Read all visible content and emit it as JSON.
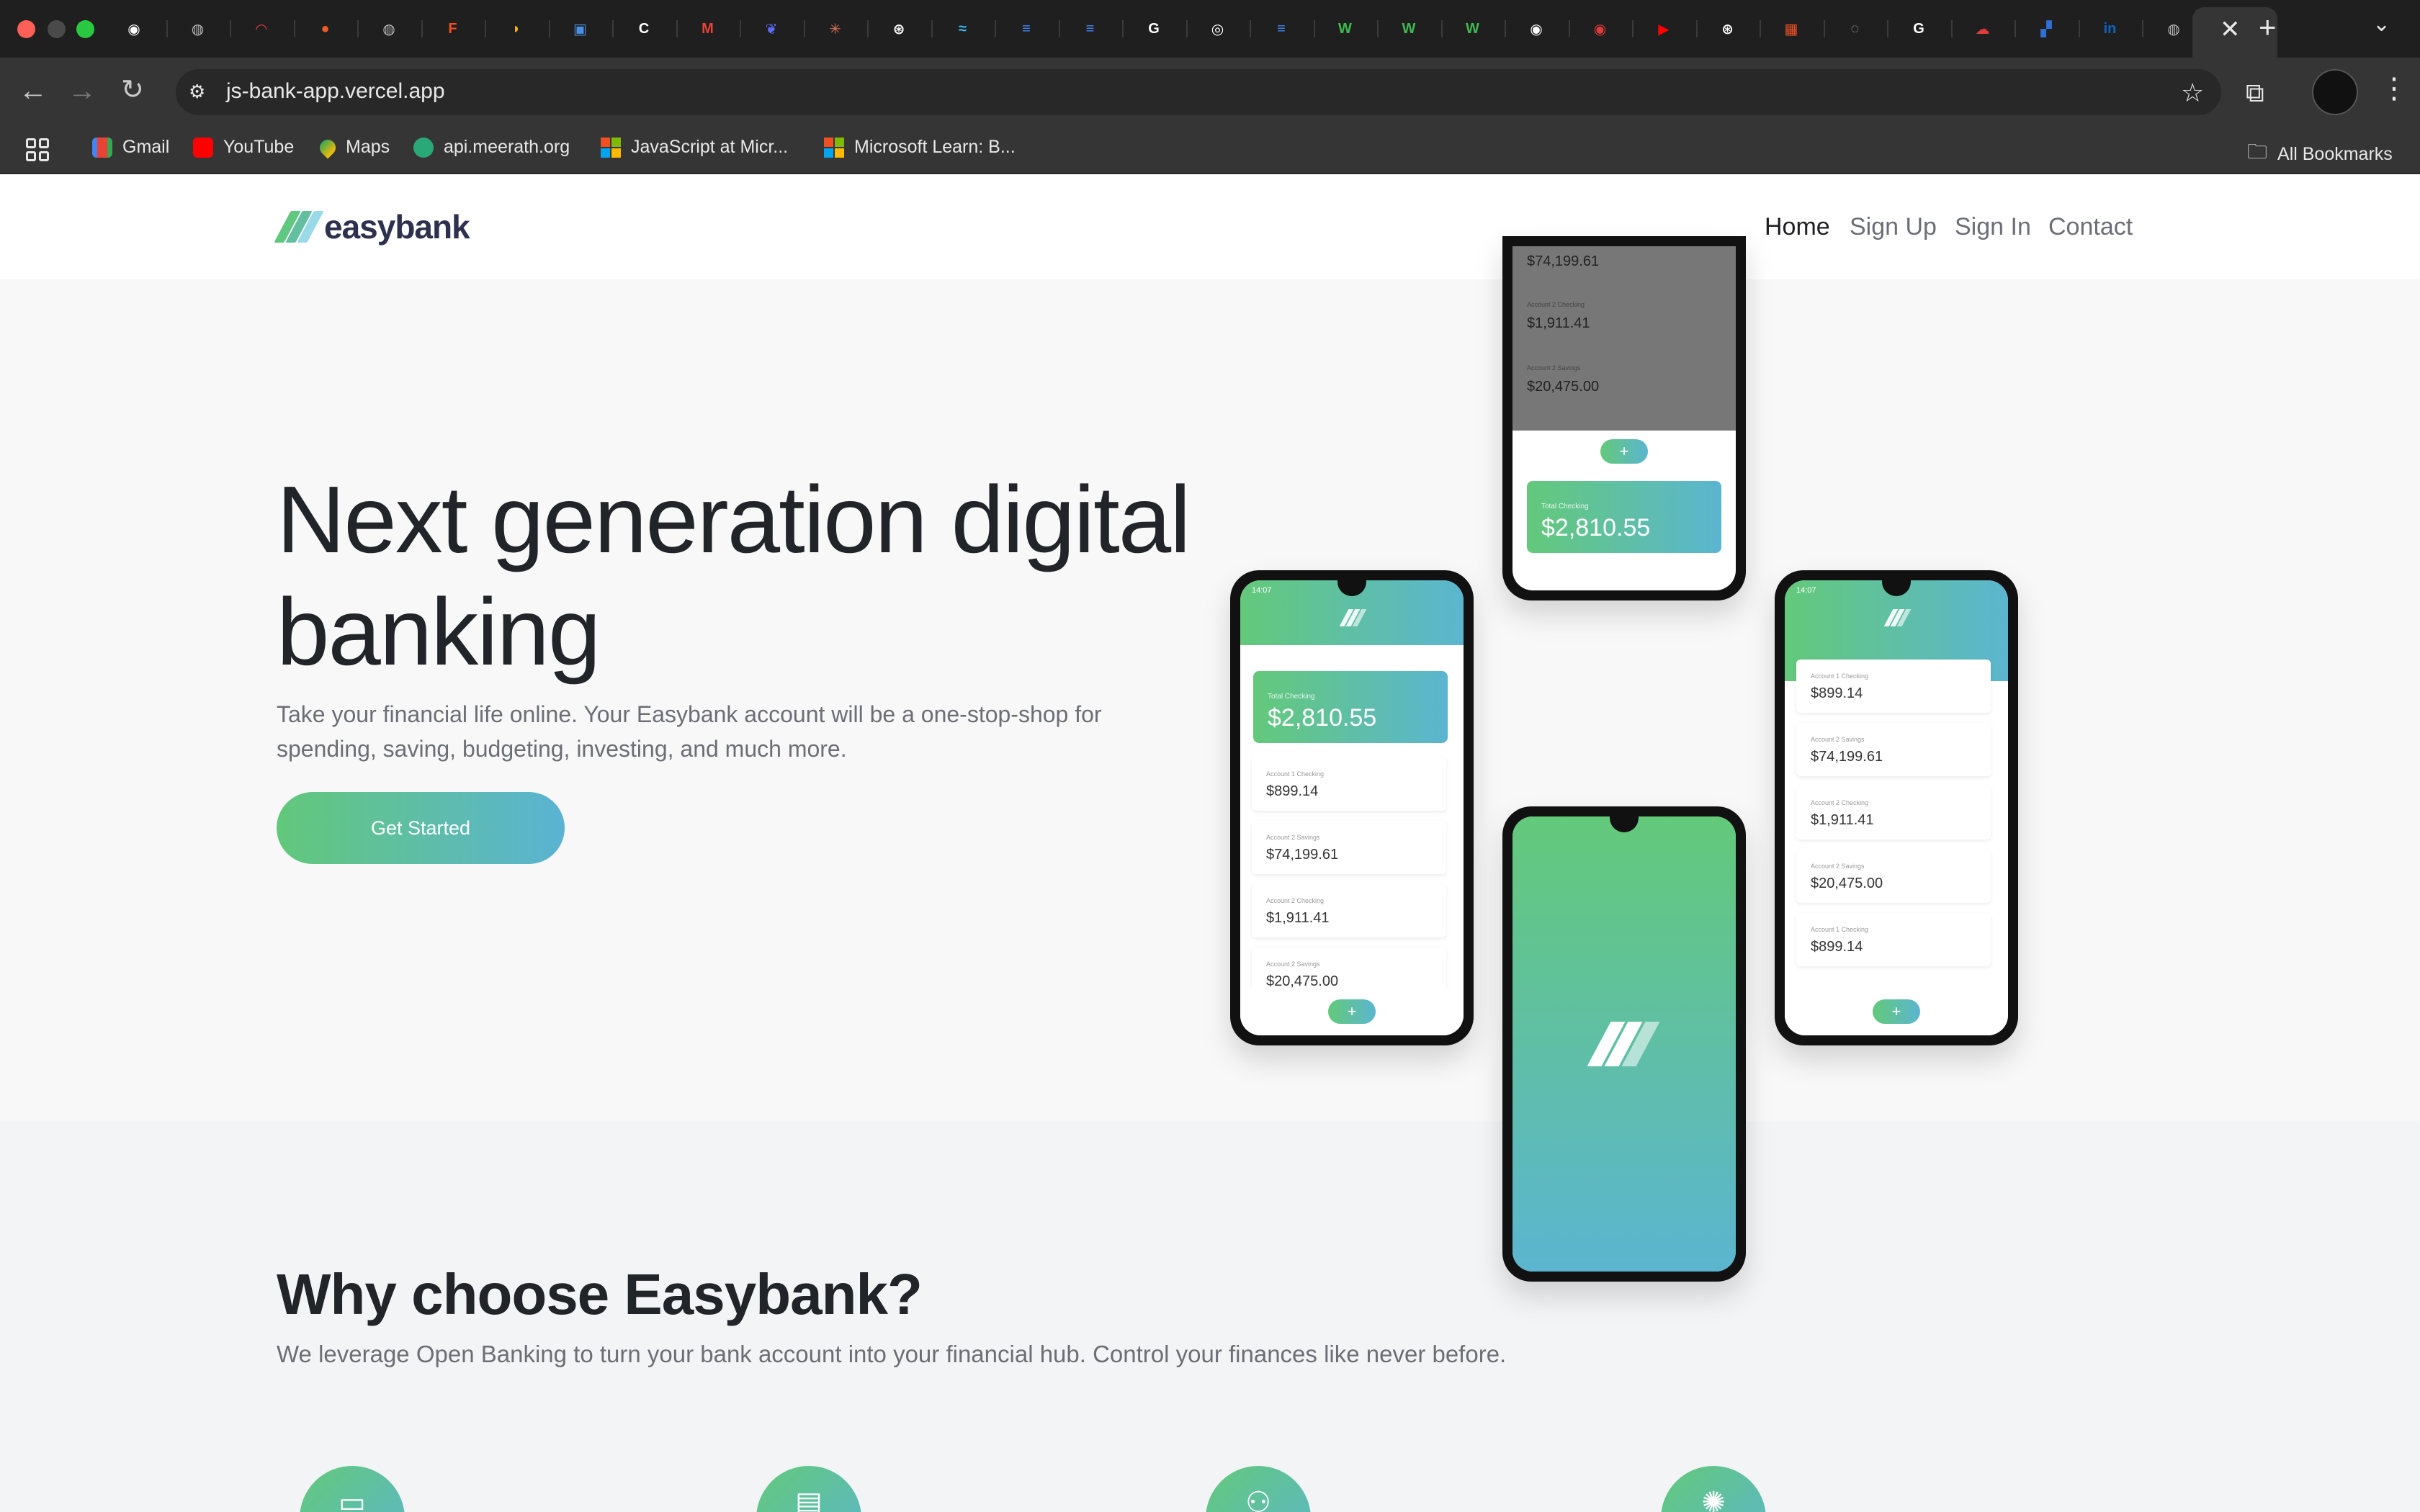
{
  "browser": {
    "url": "js-bank-app.vercel.app",
    "tab_close": "✕",
    "new_tab": "+",
    "tab_dropdown": "⌄",
    "tabs": [
      {
        "icon": "github-icon",
        "color": "#ffffff",
        "glyph": "◉"
      },
      {
        "icon": "globe-icon",
        "color": "#bbbbbb",
        "glyph": "◍"
      },
      {
        "icon": "speedometer-icon",
        "color": "#e23b3b",
        "glyph": "◠"
      },
      {
        "icon": "postman-icon",
        "color": "#ef5b25",
        "glyph": "●"
      },
      {
        "icon": "globe-icon",
        "color": "#bbbbbb",
        "glyph": "◍"
      },
      {
        "icon": "figma-icon",
        "color": "#f24e1e",
        "glyph": "F"
      },
      {
        "icon": "rainbow-icon",
        "color": "#ffb000",
        "glyph": "◗"
      },
      {
        "icon": "app-icon",
        "color": "#4a90e2",
        "glyph": "▣"
      },
      {
        "icon": "c-icon",
        "color": "#ffffff",
        "glyph": "C"
      },
      {
        "icon": "gmail-icon",
        "color": "#ea4335",
        "glyph": "M"
      },
      {
        "icon": "bird-icon",
        "color": "#5b6cff",
        "glyph": "❦"
      },
      {
        "icon": "claude-icon",
        "color": "#d97757",
        "glyph": "✳"
      },
      {
        "icon": "openai-icon",
        "color": "#ffffff",
        "glyph": "⊛"
      },
      {
        "icon": "tailwind-icon",
        "color": "#38bdf8",
        "glyph": "≈"
      },
      {
        "icon": "docs-icon",
        "color": "#4285f4",
        "glyph": "≡"
      },
      {
        "icon": "docs-icon",
        "color": "#4285f4",
        "glyph": "≡"
      },
      {
        "icon": "google-icon",
        "color": "#ffffff",
        "glyph": "G"
      },
      {
        "icon": "circle-icon",
        "color": "#ffffff",
        "glyph": "◎"
      },
      {
        "icon": "docs-icon",
        "color": "#4285f4",
        "glyph": "≡"
      },
      {
        "icon": "w-icon",
        "color": "#3fb950",
        "glyph": "W"
      },
      {
        "icon": "w-icon",
        "color": "#3fb950",
        "glyph": "W"
      },
      {
        "icon": "w-icon",
        "color": "#3fb950",
        "glyph": "W"
      },
      {
        "icon": "github-icon",
        "color": "#ffffff",
        "glyph": "◉"
      },
      {
        "icon": "record-icon",
        "color": "#e23b3b",
        "glyph": "◉"
      },
      {
        "icon": "youtube-icon",
        "color": "#ff0000",
        "glyph": "▶"
      },
      {
        "icon": "openai-icon",
        "color": "#ffffff",
        "glyph": "⊛"
      },
      {
        "icon": "microsoft-icon",
        "color": "#f25022",
        "glyph": "▦"
      },
      {
        "icon": "loading-icon",
        "color": "#aaaaaa",
        "glyph": "◌"
      },
      {
        "icon": "google-icon",
        "color": "#ffffff",
        "glyph": "G"
      },
      {
        "icon": "cloud-icon",
        "color": "#e23b3b",
        "glyph": "☁"
      },
      {
        "icon": "figure-icon",
        "color": "#2f6fd6",
        "glyph": "▞"
      },
      {
        "icon": "linkedin-icon",
        "color": "#0a66c2",
        "glyph": "in"
      },
      {
        "icon": "globe-icon",
        "color": "#bbbbbb",
        "glyph": "◍"
      }
    ],
    "bookmarks": [
      {
        "label": "Gmail",
        "icon": "gmail-icon"
      },
      {
        "label": "YouTube",
        "icon": "youtube-icon"
      },
      {
        "label": "Maps",
        "icon": "maps-icon"
      },
      {
        "label": "api.meerath.org",
        "icon": "leaf-icon"
      },
      {
        "label": "JavaScript at Micr...",
        "icon": "microsoft-icon"
      },
      {
        "label": "Microsoft Learn: B...",
        "icon": "microsoft-icon"
      }
    ],
    "all_bookmarks": "All Bookmarks"
  },
  "site": {
    "logo_text": "easybank",
    "nav": [
      "Home",
      "Sign Up",
      "Sign In",
      "Contact"
    ],
    "hero": {
      "title": "Next generation digital banking",
      "subtitle": "Take your financial life online. Your Easybank account will be a one-stop-shop for spending, saving, budgeting, investing, and much more.",
      "cta": "Get Started"
    },
    "why": {
      "title": "Why choose Easybank?",
      "subtitle": "We leverage Open Banking to turn your bank account into your financial hub. Control your finances like never before."
    },
    "feature_icons": [
      "online-banking-icon",
      "budgeting-icon",
      "onboarding-icon",
      "api-icon"
    ]
  },
  "phones": {
    "total_label": "Total Checking",
    "total": "$2,810.55",
    "time": "14:07",
    "plus": "+",
    "accounts_a": [
      {
        "label": "Account 1 Checking",
        "amount": "$899.14"
      },
      {
        "label": "Account 2 Savings",
        "amount": "$74,199.61"
      },
      {
        "label": "Account 2 Checking",
        "amount": "$1,911.41"
      },
      {
        "label": "Account 2 Savings",
        "amount": "$20,475.00"
      }
    ],
    "accounts_top": [
      {
        "label": "",
        "amount": "$74,199.61"
      },
      {
        "label": "Account 2 Checking",
        "amount": "$1,911.41"
      },
      {
        "label": "Account 2 Savings",
        "amount": "$20,475.00"
      }
    ],
    "accounts_c": [
      {
        "label": "Account 1 Checking",
        "amount": "$899.14"
      },
      {
        "label": "Account 2 Savings",
        "amount": "$74,199.61"
      },
      {
        "label": "Account 2 Checking",
        "amount": "$1,911.41"
      },
      {
        "label": "Account 2 Savings",
        "amount": "$20,475.00"
      },
      {
        "label": "Account 1 Checking",
        "amount": "$899.14"
      }
    ]
  }
}
